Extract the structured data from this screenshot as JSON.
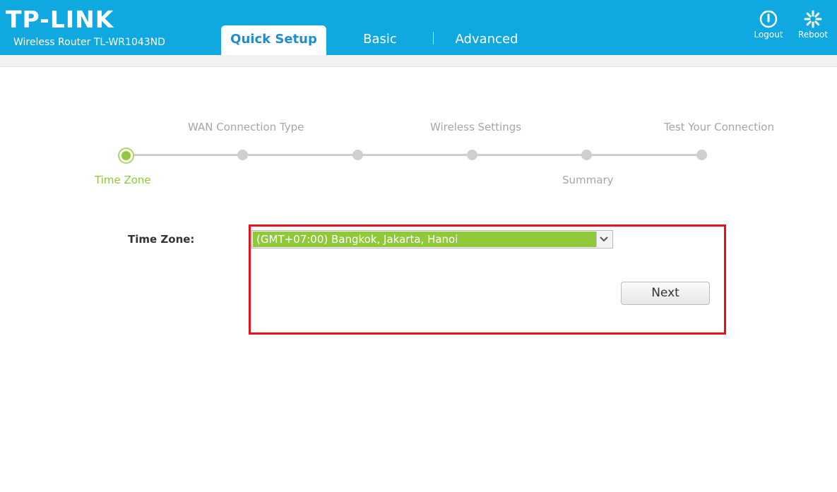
{
  "header": {
    "brand": "TP-LINK",
    "model": "Wireless Router TL-WR1043ND",
    "tabs": [
      {
        "label": "Quick Setup",
        "active": true
      },
      {
        "label": "Basic",
        "active": false
      },
      {
        "label": "Advanced",
        "active": false
      }
    ],
    "logout_label": "Logout",
    "reboot_label": "Reboot",
    "bg_color": "#10a8e0"
  },
  "progress": {
    "total_steps": 6,
    "current_step": 1,
    "top_labels": [
      "WAN Connection Type",
      "Wireless Settings",
      "Test Your Connection"
    ],
    "bottom_labels": [
      "Time Zone",
      "Summary"
    ],
    "active_color": "#8fc93a"
  },
  "form": {
    "time_zone_label": "Time Zone:",
    "time_zone_value": "(GMT+07:00) Bangkok, Jakarta, Hanoi",
    "next_label": "Next"
  }
}
